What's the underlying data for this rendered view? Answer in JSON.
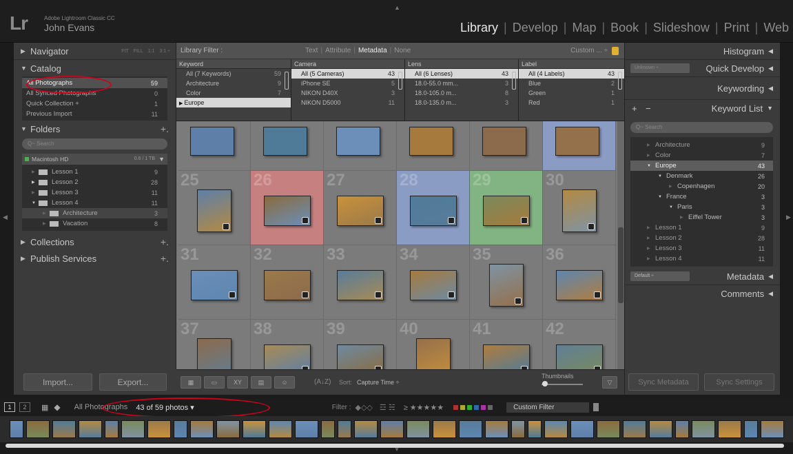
{
  "app": {
    "logo": "Lr",
    "name": "Adobe Lightroom Classic CC",
    "user": "John Evans"
  },
  "modules": [
    "Library",
    "Develop",
    "Map",
    "Book",
    "Slideshow",
    "Print",
    "Web"
  ],
  "left": {
    "navigator": {
      "label": "Navigator",
      "zoom": [
        "FIT",
        "FILL",
        "1:1",
        "3:1 ÷"
      ]
    },
    "catalog": {
      "label": "Catalog",
      "items": [
        {
          "label": "All Photographs",
          "count": "59"
        },
        {
          "label": "All Synced Photographs",
          "count": "0"
        },
        {
          "label": "Quick Collection +",
          "count": "1"
        },
        {
          "label": "Previous Import",
          "count": "11"
        }
      ]
    },
    "folders": {
      "label": "Folders",
      "search": "Q~ Search",
      "volume": {
        "label": "Macintosh HD",
        "size": "0.6 / 1 TB"
      },
      "items": [
        {
          "label": "Lesson 1",
          "count": "9"
        },
        {
          "label": "Lesson 2",
          "count": "28"
        },
        {
          "label": "Lesson 3",
          "count": "11"
        },
        {
          "label": "Lesson 4",
          "count": "11"
        },
        {
          "label": "Architecture",
          "count": "3"
        },
        {
          "label": "Vacation",
          "count": "8"
        }
      ]
    },
    "collections": "Collections",
    "publish": "Publish Services",
    "import": "Import...",
    "export": "Export..."
  },
  "filter": {
    "label": "Library Filter :",
    "options": [
      "Text",
      "Attribute",
      "Metadata",
      "None"
    ],
    "preset": "Custom ... ÷",
    "columns": [
      {
        "head": "Keyword",
        "rows": [
          {
            "label": "All (7 Keywords)",
            "n": "59"
          },
          {
            "label": "Architecture",
            "n": "9"
          },
          {
            "label": "Color",
            "n": "7"
          },
          {
            "label": "Europe",
            "n": ""
          }
        ]
      },
      {
        "head": "Camera",
        "rows": [
          {
            "label": "All (5 Cameras)",
            "n": "43"
          },
          {
            "label": "iPhone SE",
            "n": "5"
          },
          {
            "label": "NIKON D40X",
            "n": "3"
          },
          {
            "label": "NIKON D5000",
            "n": "11"
          }
        ]
      },
      {
        "head": "Lens",
        "rows": [
          {
            "label": "All (6 Lenses)",
            "n": "43"
          },
          {
            "label": "18.0-55.0 mm...",
            "n": "3"
          },
          {
            "label": "18.0-105.0 m...",
            "n": "8"
          },
          {
            "label": "18.0-135.0 m...",
            "n": "3"
          }
        ]
      },
      {
        "head": "Label",
        "rows": [
          {
            "label": "All (4 Labels)",
            "n": "43"
          },
          {
            "label": "Blue",
            "n": "2"
          },
          {
            "label": "Green",
            "n": "1"
          },
          {
            "label": "Red",
            "n": "1"
          }
        ]
      }
    ]
  },
  "grid": {
    "numbers": [
      "25",
      "26",
      "27",
      "28",
      "29",
      "30",
      "31",
      "32",
      "33",
      "34",
      "35",
      "36",
      "37",
      "38",
      "39",
      "40",
      "41",
      "42"
    ]
  },
  "toolbar": {
    "sort_label": "Sort:",
    "sort_value": "Capture Time ÷",
    "thumbnails": "Thumbnails"
  },
  "right": {
    "histogram": "Histogram",
    "quick_develop": "Quick Develop",
    "quick_develop_preset": "Unknown ÷",
    "keywording": "Keywording",
    "keyword_list": "Keyword List",
    "search": "Q~ Search",
    "keywords": [
      {
        "label": "Architecture",
        "n": "9"
      },
      {
        "label": "Color",
        "n": "7"
      },
      {
        "label": "Europe",
        "n": "43"
      },
      {
        "label": "Denmark",
        "n": "26"
      },
      {
        "label": "Copenhagen",
        "n": "20"
      },
      {
        "label": "France",
        "n": "3"
      },
      {
        "label": "Paris",
        "n": "3"
      },
      {
        "label": "Eiffel Tower",
        "n": "3"
      },
      {
        "label": "Lesson 1",
        "n": "9"
      },
      {
        "label": "Lesson 2",
        "n": "28"
      },
      {
        "label": "Lesson 3",
        "n": "11"
      },
      {
        "label": "Lesson 4",
        "n": "11"
      }
    ],
    "metadata_preset": "Default ÷",
    "metadata": "Metadata",
    "comments": "Comments",
    "sync_metadata": "Sync Metadata",
    "sync_settings": "Sync Settings"
  },
  "filmbar": {
    "screen1": "1",
    "screen2": "2",
    "source": "All Photographs",
    "count": "43 of 59 photos ▾",
    "filter_label": "Filter :",
    "custom_filter": "Custom Filter"
  },
  "colors": {
    "red_label": "#c78080",
    "blue_label": "#8b9cc4",
    "green_label": "#82b382",
    "highlight": "#d0021b"
  }
}
